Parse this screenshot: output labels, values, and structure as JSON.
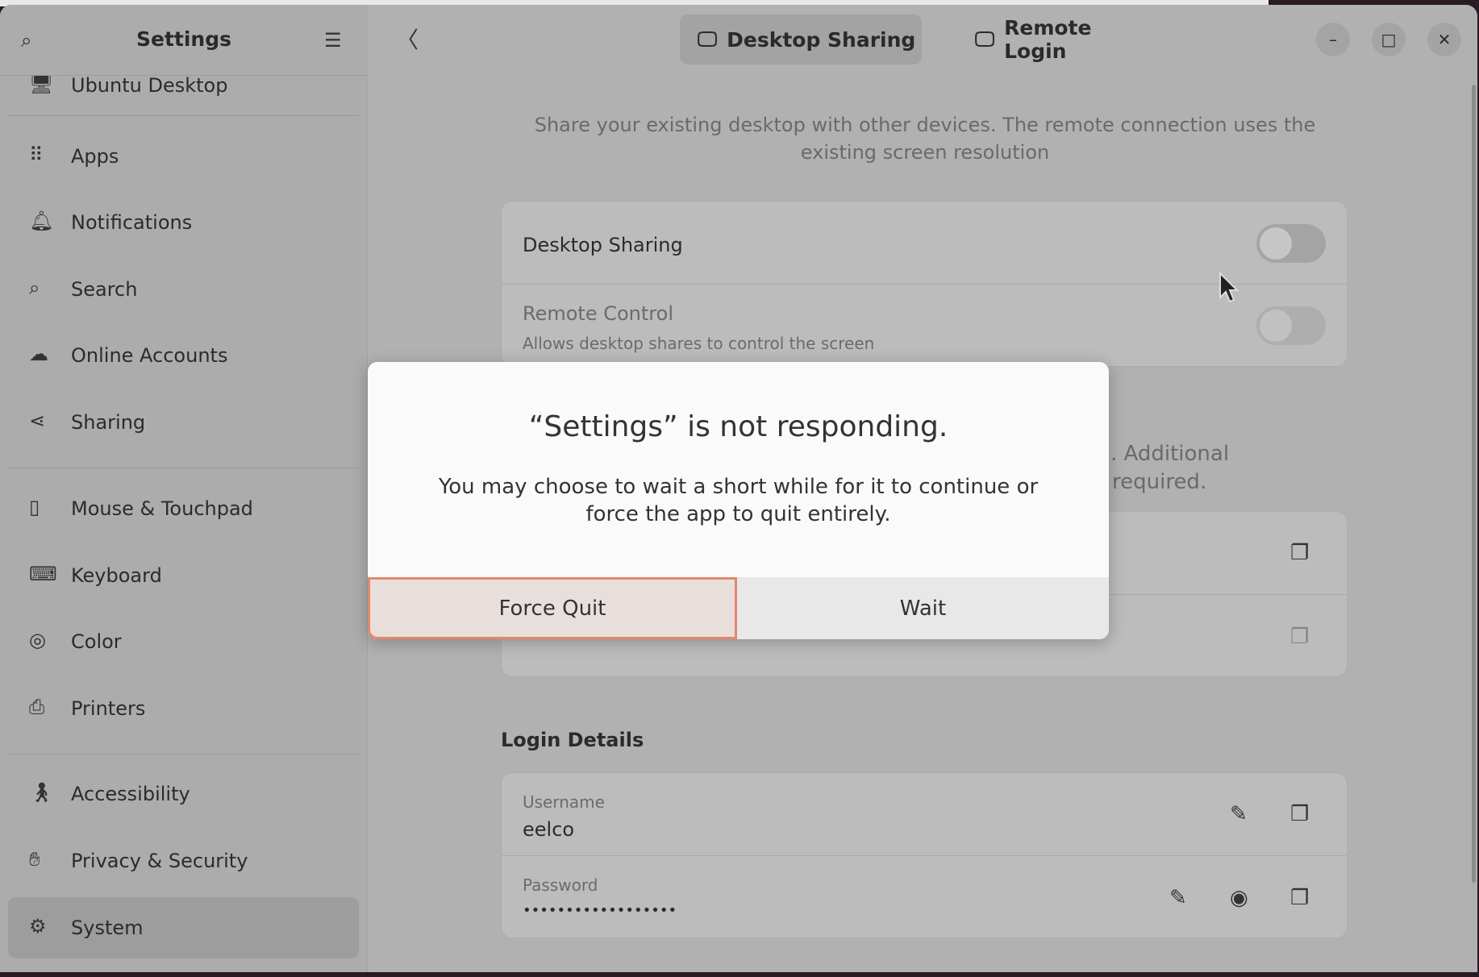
{
  "sidebar": {
    "title": "Settings",
    "partial_item": "Ubuntu Desktop",
    "items": [
      {
        "label": "Apps",
        "icon": "apps-grid-icon"
      },
      {
        "label": "Notifications",
        "icon": "bell-icon"
      },
      {
        "label": "Search",
        "icon": "search-icon"
      },
      {
        "label": "Online Accounts",
        "icon": "cloud-icon"
      },
      {
        "label": "Sharing",
        "icon": "share-icon"
      },
      {
        "label": "Mouse & Touchpad",
        "icon": "mouse-icon"
      },
      {
        "label": "Keyboard",
        "icon": "keyboard-icon"
      },
      {
        "label": "Color",
        "icon": "color-icon"
      },
      {
        "label": "Printers",
        "icon": "printer-icon"
      },
      {
        "label": "Accessibility",
        "icon": "accessibility-icon"
      },
      {
        "label": "Privacy & Security",
        "icon": "hand-icon"
      },
      {
        "label": "System",
        "icon": "gear-icon",
        "selected": true
      }
    ]
  },
  "header": {
    "tabs": [
      {
        "label": "Desktop Sharing",
        "active": true
      },
      {
        "label": "Remote Login",
        "active": false
      }
    ]
  },
  "content": {
    "description": "Share your existing desktop with other devices. The remote connection uses the existing screen resolution",
    "desktop_sharing": {
      "label": "Desktop Sharing",
      "on": false
    },
    "remote_control": {
      "label": "Remote Control",
      "sublabel": "Allows desktop shares to control the screen",
      "on": false,
      "disabled": true
    },
    "fragment1": ". Additional",
    "fragment2": "required.",
    "login_details": {
      "title": "Login Details",
      "username_label": "Username",
      "username": "eelco",
      "password_label": "Password",
      "password": "••••••••••••••••••"
    }
  },
  "dialog": {
    "title": "“Settings” is not responding.",
    "body": "You may choose to wait a short while for it to continue or force the app to quit entirely.",
    "force_quit": "Force Quit",
    "wait": "Wait",
    "accent": "#e3876a"
  }
}
